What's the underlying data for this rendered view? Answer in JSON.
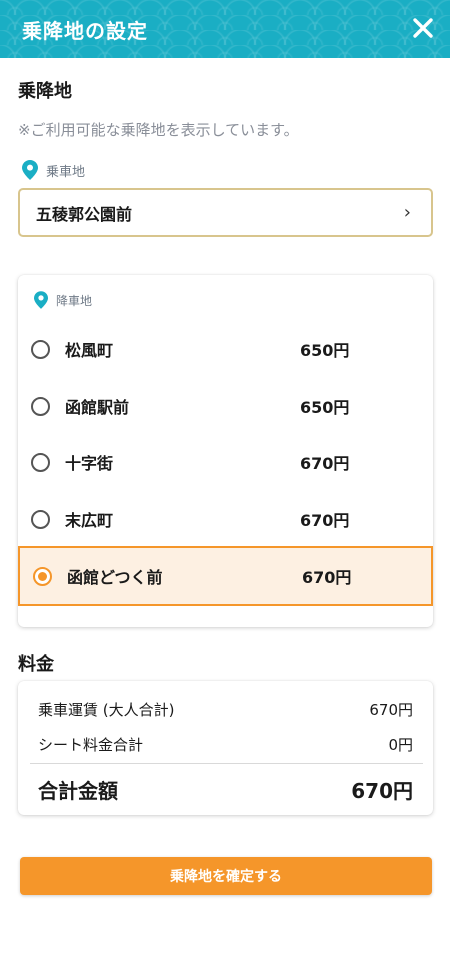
{
  "header": {
    "title": "乗降地の設定"
  },
  "boarding_section": {
    "title": "乗降地",
    "note": "※ご利用可能な乗降地を表示しています。",
    "board_label": "乗車地",
    "board_value": "五稜郭公園前",
    "chevron": "›"
  },
  "alighting": {
    "label": "降車地",
    "options": [
      {
        "name": "松風町",
        "price": "650円",
        "selected": false
      },
      {
        "name": "函館駅前",
        "price": "650円",
        "selected": false
      },
      {
        "name": "十字街",
        "price": "670円",
        "selected": false
      },
      {
        "name": "末広町",
        "price": "670円",
        "selected": false
      },
      {
        "name": "函館どつく前",
        "price": "670円",
        "selected": true
      }
    ]
  },
  "fare": {
    "title": "料金",
    "fare_label": "乗車運賃 (大人合計)",
    "fare_value": "670円",
    "seat_label": "シート料金合計",
    "seat_value": "0円",
    "total_label": "合計金額",
    "total_value": "670円"
  },
  "confirm_button": {
    "label": "乗降地を確定する"
  },
  "colors": {
    "header": "#1aaec4",
    "accent": "#f5962a",
    "pin": "#1aaec4",
    "select_border": "#d8c58d"
  },
  "icons": {
    "close": "close-icon",
    "pin": "map-pin-icon",
    "chevron": "chevron-right-icon"
  }
}
